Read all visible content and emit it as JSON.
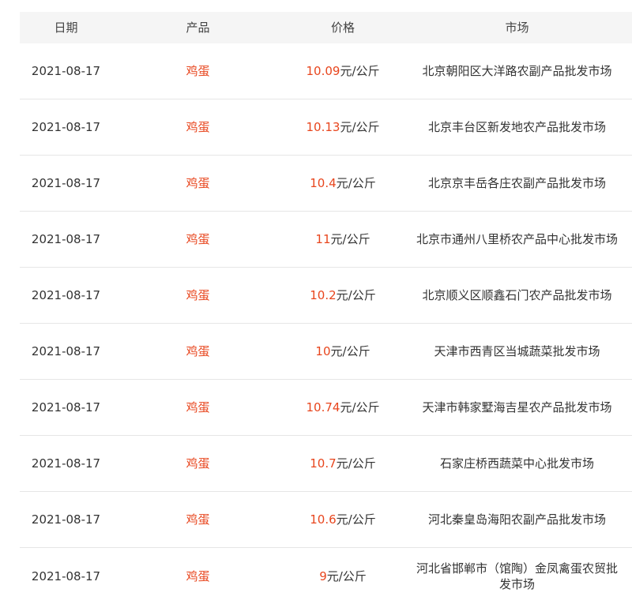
{
  "colors": {
    "accent": "#e8461e",
    "header_bg": "#f5f5f5",
    "divider": "#e6e6e6"
  },
  "table": {
    "headers": {
      "date": "日期",
      "product": "产品",
      "price": "价格",
      "market": "市场"
    },
    "unit": "元/公斤",
    "rows": [
      {
        "date": "2021-08-17",
        "product": "鸡蛋",
        "price": "10.09",
        "market": "北京朝阳区大洋路农副产品批发市场"
      },
      {
        "date": "2021-08-17",
        "product": "鸡蛋",
        "price": "10.13",
        "market": "北京丰台区新发地农产品批发市场"
      },
      {
        "date": "2021-08-17",
        "product": "鸡蛋",
        "price": "10.4",
        "market": "北京京丰岳各庄农副产品批发市场"
      },
      {
        "date": "2021-08-17",
        "product": "鸡蛋",
        "price": "11",
        "market": "北京市通州八里桥农产品中心批发市场"
      },
      {
        "date": "2021-08-17",
        "product": "鸡蛋",
        "price": "10.2",
        "market": "北京顺义区顺鑫石门农产品批发市场"
      },
      {
        "date": "2021-08-17",
        "product": "鸡蛋",
        "price": "10",
        "market": "天津市西青区当城蔬菜批发市场"
      },
      {
        "date": "2021-08-17",
        "product": "鸡蛋",
        "price": "10.74",
        "market": "天津市韩家墅海吉星农产品批发市场"
      },
      {
        "date": "2021-08-17",
        "product": "鸡蛋",
        "price": "10.7",
        "market": "石家庄桥西蔬菜中心批发市场"
      },
      {
        "date": "2021-08-17",
        "product": "鸡蛋",
        "price": "10.6",
        "market": "河北秦皇岛海阳农副产品批发市场"
      },
      {
        "date": "2021-08-17",
        "product": "鸡蛋",
        "price": "9",
        "market": "河北省邯郸市（馆陶）金凤禽蛋农贸批发市场"
      }
    ]
  }
}
